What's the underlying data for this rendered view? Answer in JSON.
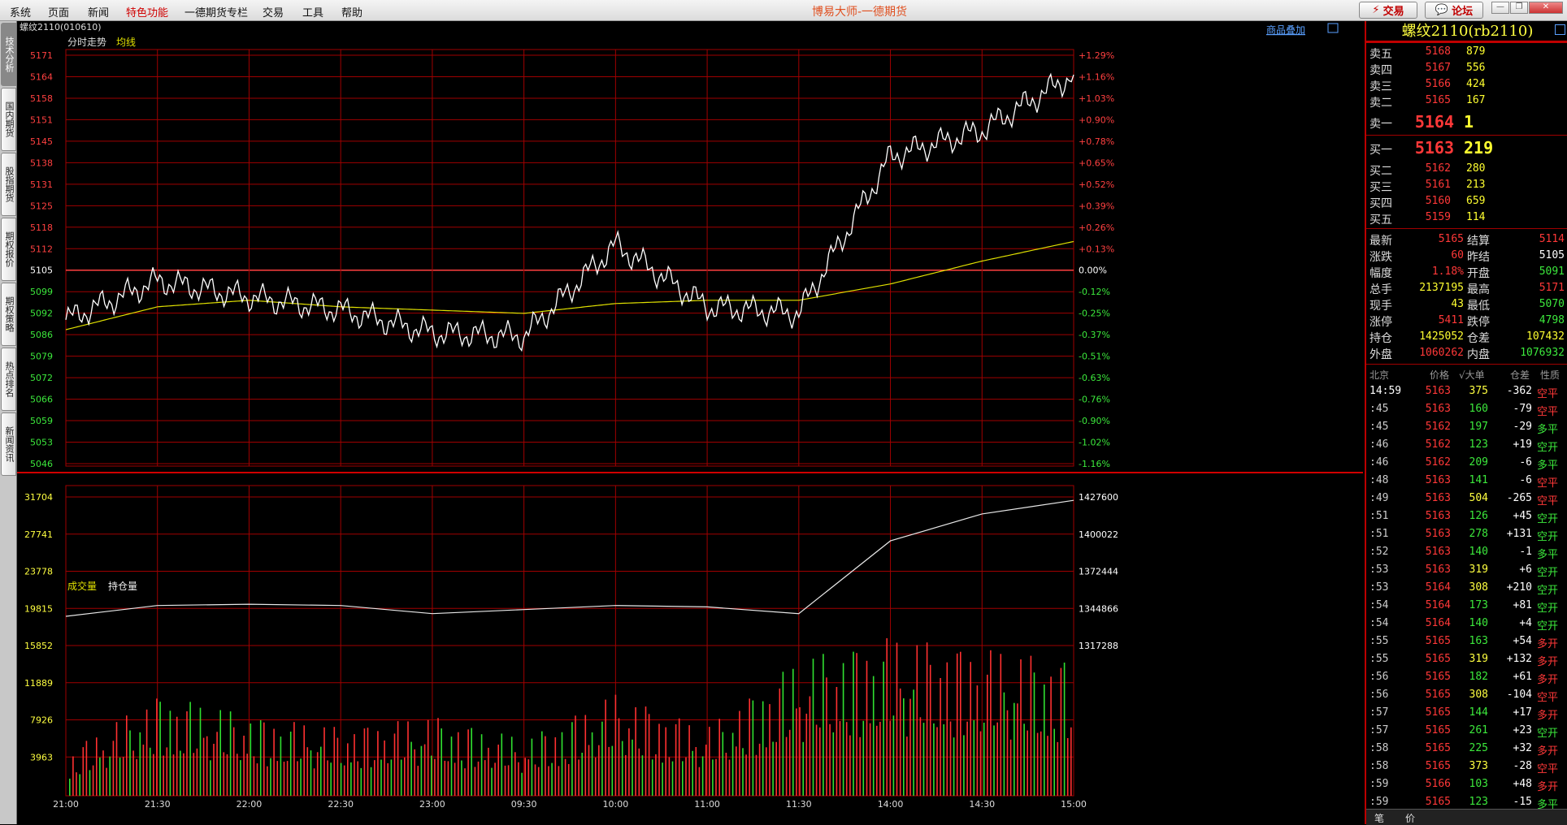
{
  "menu": [
    "系统",
    "页面",
    "新闻",
    "特色功能",
    "一德期货专栏",
    "交易",
    "工具",
    "帮助"
  ],
  "app_title": "博易大师-一德期货",
  "top_buttons": {
    "trade": "交易",
    "forum": "论坛"
  },
  "left_tabs": [
    "技术分析",
    "国内期货",
    "股指期货",
    "期权报价",
    "期权策略",
    "热点排名",
    "新闻资讯"
  ],
  "chart": {
    "instrument": "螺纹2110(010610)",
    "legend": {
      "line1": "分时走势",
      "line2": "均线"
    },
    "overlay_link": "商品叠加",
    "price_axis": [
      "5171",
      "5164",
      "5158",
      "5151",
      "5145",
      "5138",
      "5131",
      "5125",
      "5118",
      "5112",
      "5105",
      "5099",
      "5092",
      "5086",
      "5079",
      "5072",
      "5066",
      "5059",
      "5053",
      "5046"
    ],
    "pct_axis": [
      "+1.29%",
      "+1.16%",
      "+1.03%",
      "+0.90%",
      "+0.78%",
      "+0.65%",
      "+0.52%",
      "+0.39%",
      "+0.26%",
      "+0.13%",
      "0.00%",
      "-0.12%",
      "-0.25%",
      "-0.37%",
      "-0.51%",
      "-0.63%",
      "-0.76%",
      "-0.90%",
      "-1.02%",
      "-1.16%"
    ],
    "volume_legend": {
      "volume": "成交量",
      "oi": "持仓量"
    },
    "volume_axis": [
      "31704",
      "27741",
      "23778",
      "19815",
      "15852",
      "11889",
      "7926",
      "3963"
    ],
    "oi_axis": [
      "1427600",
      "1400022",
      "1372444",
      "1344866",
      "1317288"
    ],
    "time_axis": [
      "21:00",
      "21:30",
      "22:00",
      "22:30",
      "23:00",
      "09:30",
      "10:00",
      "11:00",
      "11:30",
      "14:00",
      "14:30",
      "15:00"
    ]
  },
  "chart_data": {
    "type": "line",
    "title": "螺纹2110(010610)",
    "x": [
      "21:00",
      "21:30",
      "22:00",
      "22:30",
      "23:00",
      "09:30",
      "10:00",
      "11:00",
      "11:30",
      "14:00",
      "14:30",
      "15:00"
    ],
    "series": [
      {
        "name": "分时走势",
        "values": [
          5090,
          5102,
          5097,
          5093,
          5086,
          5085,
          5113,
          5094,
          5092,
          5140,
          5148,
          5165
        ]
      },
      {
        "name": "均线",
        "values": [
          5087,
          5094,
          5096,
          5094,
          5093,
          5092,
          5095,
          5096,
          5096,
          5101,
          5108,
          5114
        ]
      }
    ],
    "volume": [
      4000,
      9000,
      7000,
      6000,
      7000,
      5000,
      9000,
      6000,
      12000,
      14000,
      13000,
      12000
    ],
    "open_interest": [
      1339000,
      1347000,
      1348000,
      1347000,
      1341000,
      1344000,
      1347000,
      1346000,
      1341000,
      1395000,
      1415000,
      1425052
    ],
    "ylim": [
      5046,
      5171
    ],
    "reference_price": 5105
  },
  "quote": {
    "title": "螺纹2110(rb2110)",
    "asks": [
      {
        "label": "卖五",
        "price": "5168",
        "vol": "879"
      },
      {
        "label": "卖四",
        "price": "5167",
        "vol": "556"
      },
      {
        "label": "卖三",
        "price": "5166",
        "vol": "424"
      },
      {
        "label": "卖二",
        "price": "5165",
        "vol": "167"
      }
    ],
    "ask1": {
      "label": "卖一",
      "price": "5164",
      "vol": "1"
    },
    "bid1": {
      "label": "买一",
      "price": "5163",
      "vol": "219"
    },
    "bids": [
      {
        "label": "买二",
        "price": "5162",
        "vol": "280"
      },
      {
        "label": "买三",
        "price": "5161",
        "vol": "213"
      },
      {
        "label": "买四",
        "price": "5160",
        "vol": "659"
      },
      {
        "label": "买五",
        "price": "5159",
        "vol": "114"
      }
    ],
    "stats": [
      {
        "l1": "最新",
        "v1": "5165",
        "c1": "red",
        "l2": "结算",
        "v2": "5114",
        "c2": "red"
      },
      {
        "l1": "涨跌",
        "v1": "60",
        "c1": "red",
        "l2": "昨结",
        "v2": "5105",
        "c2": "white"
      },
      {
        "l1": "幅度",
        "v1": "1.18%",
        "c1": "red",
        "l2": "开盘",
        "v2": "5091",
        "c2": "green"
      },
      {
        "l1": "总手",
        "v1": "2137195",
        "c1": "yellow",
        "l2": "最高",
        "v2": "5171",
        "c2": "red"
      },
      {
        "l1": "现手",
        "v1": "43",
        "c1": "yellow",
        "l2": "最低",
        "v2": "5070",
        "c2": "green"
      },
      {
        "l1": "涨停",
        "v1": "5411",
        "c1": "red",
        "l2": "跌停",
        "v2": "4798",
        "c2": "green"
      },
      {
        "l1": "持仓",
        "v1": "1425052",
        "c1": "yellow",
        "l2": "仓差",
        "v2": "107432",
        "c2": "yellow"
      },
      {
        "l1": "外盘",
        "v1": "1060262",
        "c1": "red",
        "l2": "内盘",
        "v2": "1076932",
        "c2": "green"
      }
    ],
    "ticks_header": {
      "time": "北京",
      "price": "价格",
      "vol": "√大单",
      "diff": "仓差",
      "type": "性质"
    },
    "ticks": [
      {
        "t": "14:59",
        "p": "5163",
        "v": "375",
        "d": "-362",
        "n": "空平",
        "nc": "red"
      },
      {
        "t": ":45",
        "p": "5163",
        "v": "160",
        "d": "-79",
        "n": "空平",
        "nc": "red"
      },
      {
        "t": ":45",
        "p": "5162",
        "v": "197",
        "d": "-29",
        "n": "多平",
        "nc": "green"
      },
      {
        "t": ":46",
        "p": "5162",
        "v": "123",
        "d": "+19",
        "n": "空开",
        "nc": "green"
      },
      {
        "t": ":46",
        "p": "5162",
        "v": "209",
        "d": "-6",
        "n": "多平",
        "nc": "green"
      },
      {
        "t": ":48",
        "p": "5163",
        "v": "141",
        "d": "-6",
        "n": "空平",
        "nc": "red"
      },
      {
        "t": ":49",
        "p": "5163",
        "v": "504",
        "d": "-265",
        "n": "空平",
        "nc": "red"
      },
      {
        "t": ":51",
        "p": "5163",
        "v": "126",
        "d": "+45",
        "n": "空开",
        "nc": "green"
      },
      {
        "t": ":51",
        "p": "5163",
        "v": "278",
        "d": "+131",
        "n": "空开",
        "nc": "green"
      },
      {
        "t": ":52",
        "p": "5163",
        "v": "140",
        "d": "-1",
        "n": "多平",
        "nc": "green"
      },
      {
        "t": ":53",
        "p": "5163",
        "v": "319",
        "d": "+6",
        "n": "空开",
        "nc": "green"
      },
      {
        "t": ":53",
        "p": "5164",
        "v": "308",
        "d": "+210",
        "n": "空开",
        "nc": "green"
      },
      {
        "t": ":54",
        "p": "5164",
        "v": "173",
        "d": "+81",
        "n": "空开",
        "nc": "green"
      },
      {
        "t": ":54",
        "p": "5164",
        "v": "140",
        "d": "+4",
        "n": "空开",
        "nc": "green"
      },
      {
        "t": ":55",
        "p": "5165",
        "v": "163",
        "d": "+54",
        "n": "多开",
        "nc": "red"
      },
      {
        "t": ":55",
        "p": "5165",
        "v": "319",
        "d": "+132",
        "n": "多开",
        "nc": "red"
      },
      {
        "t": ":56",
        "p": "5165",
        "v": "182",
        "d": "+61",
        "n": "多开",
        "nc": "red"
      },
      {
        "t": ":56",
        "p": "5165",
        "v": "308",
        "d": "-104",
        "n": "空平",
        "nc": "red"
      },
      {
        "t": ":57",
        "p": "5165",
        "v": "144",
        "d": "+17",
        "n": "多开",
        "nc": "red"
      },
      {
        "t": ":57",
        "p": "5165",
        "v": "261",
        "d": "+23",
        "n": "空开",
        "nc": "green"
      },
      {
        "t": ":58",
        "p": "5165",
        "v": "225",
        "d": "+32",
        "n": "多开",
        "nc": "red"
      },
      {
        "t": ":58",
        "p": "5165",
        "v": "373",
        "d": "-28",
        "n": "空平",
        "nc": "red"
      },
      {
        "t": ":59",
        "p": "5166",
        "v": "103",
        "d": "+48",
        "n": "多开",
        "nc": "red"
      },
      {
        "t": ":59",
        "p": "5165",
        "v": "123",
        "d": "-15",
        "n": "多平",
        "nc": "green"
      }
    ],
    "bottom_tabs": [
      "笔",
      "价"
    ]
  },
  "colors": {
    "grid": "#b00000",
    "price_line": "#ffffff",
    "avg_line": "#e0e000",
    "up": "#ff3030",
    "down": "#30e030"
  }
}
